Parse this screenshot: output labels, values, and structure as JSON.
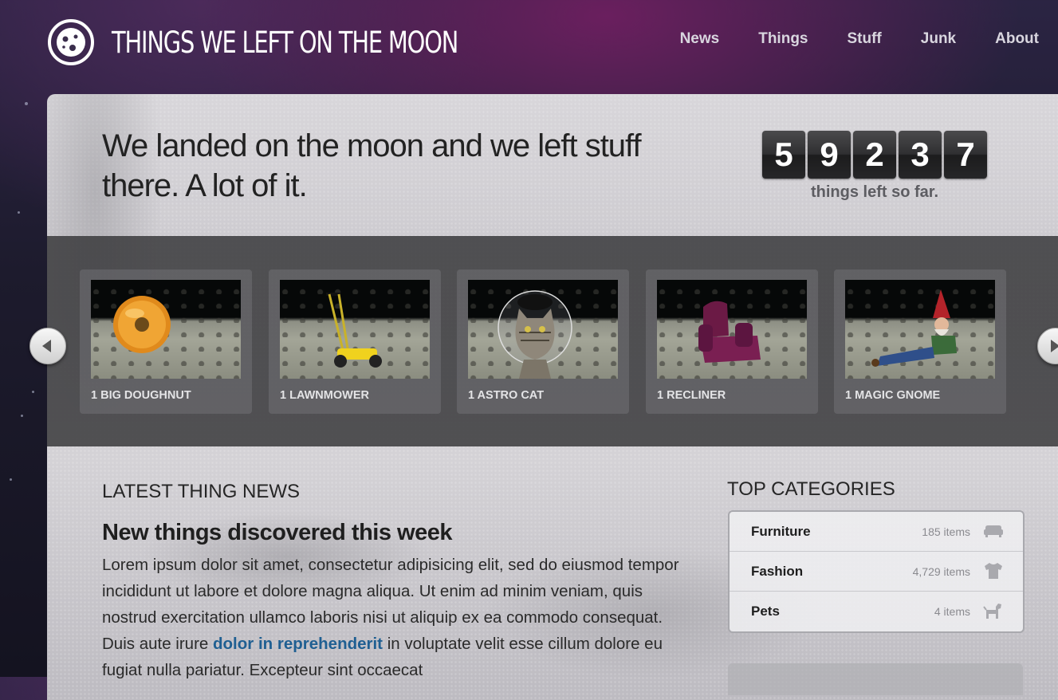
{
  "site": {
    "title": "THINGS WE LEFT ON THE MOON"
  },
  "nav": [
    {
      "label": "News"
    },
    {
      "label": "Things"
    },
    {
      "label": "Stuff"
    },
    {
      "label": "Junk"
    },
    {
      "label": "About"
    }
  ],
  "hero": {
    "headline": "We landed on the moon and we left stuff there. A lot of it.",
    "counter_digits": [
      "5",
      "9",
      "2",
      "3",
      "7"
    ],
    "counter_caption": "things left so far."
  },
  "carousel": {
    "items": [
      {
        "label": "1 BIG DOUGHNUT",
        "icon": "doughnut-image"
      },
      {
        "label": "1 LAWNMOWER",
        "icon": "lawnmower-image"
      },
      {
        "label": "1 ASTRO CAT",
        "icon": "astro-cat-image"
      },
      {
        "label": "1 RECLINER",
        "icon": "recliner-image"
      },
      {
        "label": "1 MAGIC GNOME",
        "icon": "gnome-image"
      }
    ],
    "prev_icon": "chevron-left-icon",
    "next_icon": "chevron-right-icon"
  },
  "news": {
    "section_title": "LATEST THING NEWS",
    "headline": "New things discovered this week",
    "body_before": "Lorem ipsum dolor sit amet, consectetur adipisicing elit, sed do eiusmod tempor incididunt ut labore et dolore magna aliqua. Ut enim ad minim veniam, quis nostrud exercitation ullamco laboris nisi ut aliquip ex ea commodo consequat. Duis aute irure ",
    "body_link": "dolor in reprehenderit",
    "body_after": " in voluptate velit esse cillum dolore eu fugiat nulla pariatur. Excepteur sint occaecat"
  },
  "categories": {
    "section_title": "TOP CATEGORIES",
    "items": [
      {
        "name": "Furniture",
        "count": "185 items",
        "icon": "sofa-icon"
      },
      {
        "name": "Fashion",
        "count": "4,729 items",
        "icon": "tshirt-icon"
      },
      {
        "name": "Pets",
        "count": "4 items",
        "icon": "dog-icon"
      }
    ]
  },
  "colors": {
    "link": "#1f5f92",
    "accent_purple": "#6a1f5e"
  }
}
